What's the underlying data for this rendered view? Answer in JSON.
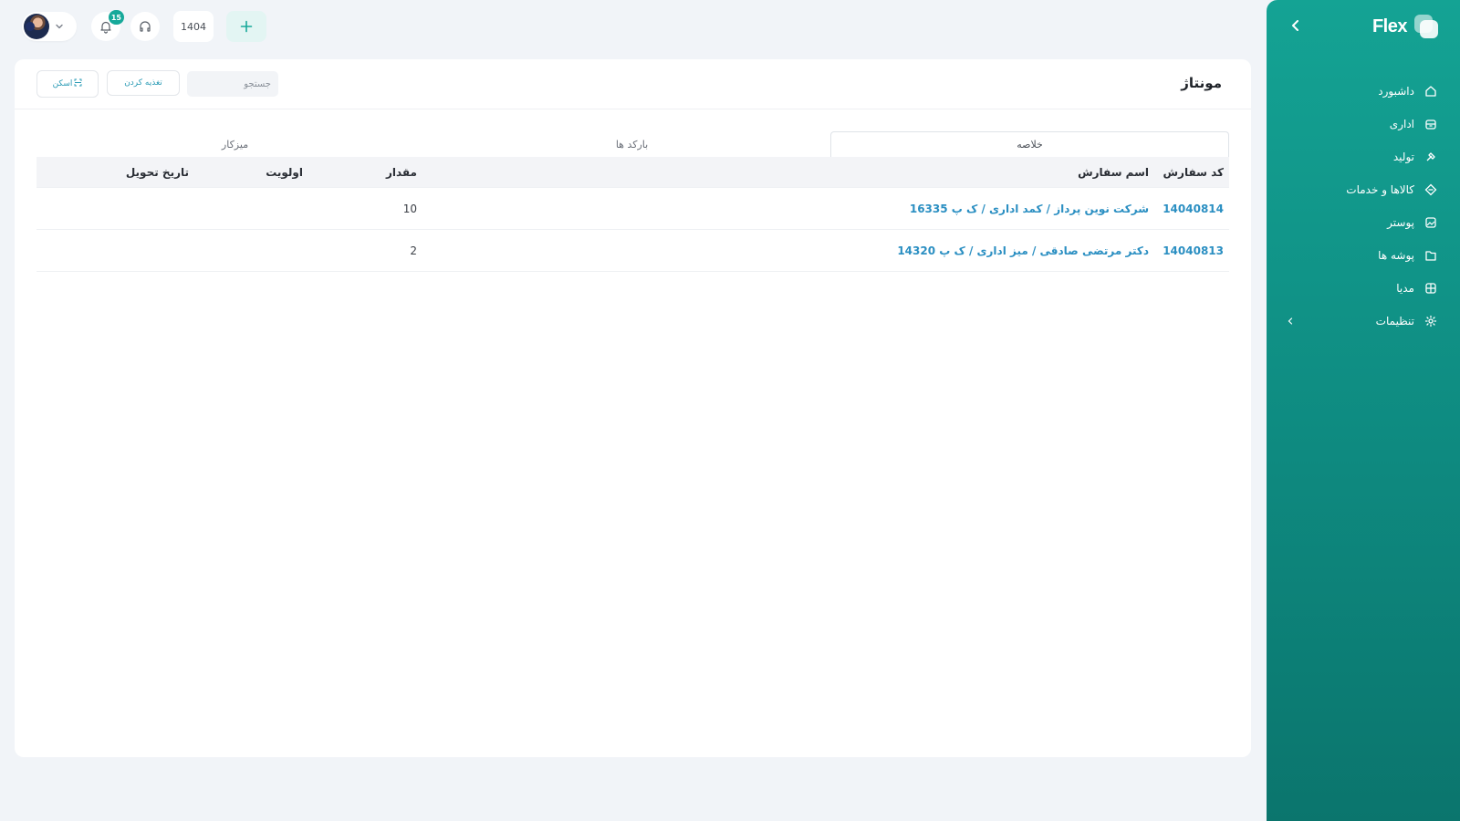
{
  "app": {
    "name": "Flex"
  },
  "sidebar": {
    "items": [
      {
        "label": "داشبورد",
        "icon": "home-icon"
      },
      {
        "label": "اداری",
        "icon": "archive-icon"
      },
      {
        "label": "تولید",
        "icon": "tool-icon"
      },
      {
        "label": "کالاها و خدمات",
        "icon": "diamond-icon"
      },
      {
        "label": "پوستر",
        "icon": "image-icon"
      },
      {
        "label": "پوشه ها",
        "icon": "folder-icon"
      },
      {
        "label": "مدیا",
        "icon": "grid-icon"
      },
      {
        "label": "تنظیمات",
        "icon": "gear-icon",
        "expandable": true
      }
    ]
  },
  "topbar": {
    "notifications_count": "15",
    "year": "1404"
  },
  "page": {
    "title": "مونتاژ",
    "search_placeholder": "جستجو",
    "feed_label": "تغذیه کردن",
    "scan_label": "اسکن"
  },
  "tabs": [
    {
      "label": "خلاصه",
      "active": true
    },
    {
      "label": "بارکد ها",
      "active": false
    },
    {
      "label": "میزکار",
      "active": false
    }
  ],
  "table": {
    "headers": {
      "code": "کد سفارش",
      "name": "اسم سفارش",
      "qty": "مقدار",
      "priority": "اولویت",
      "delivery": "تاریخ تحویل"
    },
    "rows": [
      {
        "code": "14040814",
        "name": "شرکت نوین پرداز / کمد اداری / ک پ 16335",
        "qty": "10",
        "priority": "",
        "delivery": ""
      },
      {
        "code": "14040813",
        "name": "دکتر مرتضی صادقی / میز اداری / ک پ 14320",
        "qty": "2",
        "priority": "",
        "delivery": ""
      }
    ]
  },
  "colors": {
    "brand": "#14a394",
    "link": "#2b8fc2",
    "badge": "#17a99a"
  }
}
